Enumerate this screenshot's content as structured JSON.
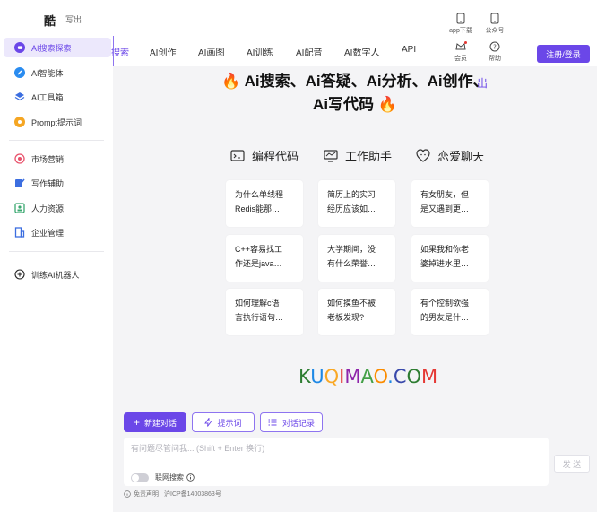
{
  "brand": {
    "name": "酷",
    "subtitle": "写出"
  },
  "sidebar": {
    "items": [
      {
        "label": "AI搜索探索",
        "icon": "chat-bubble-icon",
        "color": "#6b47e8",
        "active": true
      },
      {
        "label": "AI智能体",
        "icon": "pen-circle-icon",
        "color": "#2a8cf0",
        "active": false
      },
      {
        "label": "AI工具箱",
        "icon": "layers-icon",
        "color": "#3c6ee0",
        "active": false
      },
      {
        "label": "Prompt提示词",
        "icon": "bulb-icon",
        "color": "#f5a623",
        "active": false
      }
    ],
    "items2": [
      {
        "label": "市场营销",
        "icon": "target-icon",
        "color": "#e8506a"
      },
      {
        "label": "写作辅助",
        "icon": "write-icon",
        "color": "#3c6ee0"
      },
      {
        "label": "人力资源",
        "icon": "person-card-icon",
        "color": "#3aa870"
      },
      {
        "label": "企业管理",
        "icon": "building-icon",
        "color": "#3c6ee0"
      }
    ],
    "train": {
      "label": "训练AI机器人",
      "icon": "plus-circle-icon"
    }
  },
  "header": {
    "tabs": [
      "搜索",
      "AI创作",
      "AI画图",
      "AI训练",
      "AI配音",
      "AI数字人",
      "API"
    ],
    "active_tab": 0,
    "app_download": "app下载",
    "official_account": "公众号",
    "vip": "会员",
    "help": "帮助",
    "login": "注册/登录",
    "overlap_text": "出"
  },
  "hero": {
    "line1": "Ai搜索、Ai答疑、Ai分析、Ai创作、",
    "line2": "Ai写代码",
    "emoji": "🔥"
  },
  "categories": [
    {
      "label": "编程代码",
      "icon": "code-window-icon"
    },
    {
      "label": "工作助手",
      "icon": "monitor-icon"
    },
    {
      "label": "恋爱聊天",
      "icon": "heart-face-icon"
    }
  ],
  "cards": [
    [
      "为什么单线程",
      "Redis能那…"
    ],
    [
      "简历上的实习",
      "经历应该如…"
    ],
    [
      "有女朋友，但",
      "是又遇到更…"
    ],
    [
      "C++容易找工",
      "作还是java…"
    ],
    [
      "大学期间，没",
      "有什么荣誉…"
    ],
    [
      "如果我和你老",
      "婆掉进水里…"
    ],
    [
      "如何理解c语",
      "言执行语句…"
    ],
    [
      "如何摸鱼不被",
      "老板发现?"
    ],
    [
      "有个控制欲强",
      "的男友是什…"
    ]
  ],
  "watermark": {
    "text": "KUQIMAO.COM"
  },
  "toolbar": {
    "new_chat": "新建对话",
    "prompts": "提示词",
    "history": "对话记录"
  },
  "input": {
    "placeholder": "有问题尽管问我... (Shift + Enter 换行)",
    "web_search": "联网搜索",
    "send": "发 送"
  },
  "footer": {
    "disclaimer": "免责声明",
    "icp": "沪ICP备14003863号"
  },
  "colors": {
    "accent": "#6b47e8",
    "background": "#f4f4f6"
  }
}
